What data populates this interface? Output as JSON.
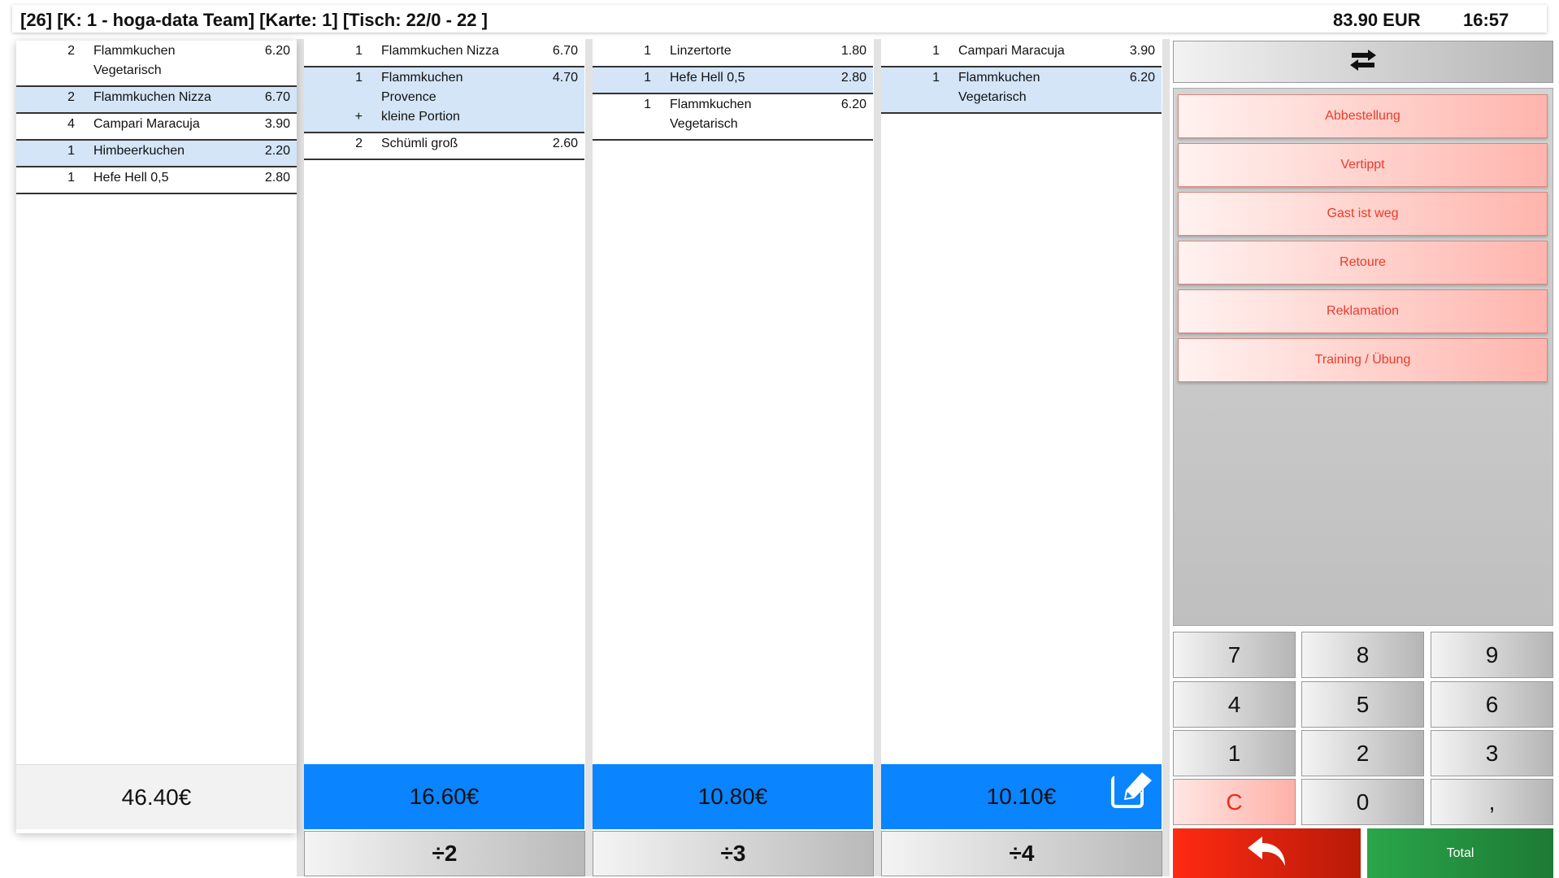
{
  "header": {
    "title": "[26] [K: 1 - hoga-data Team] [Karte: 1] [Tisch: 22/0 - 22 ]",
    "amount": "83.90 EUR",
    "time": "16:57"
  },
  "columns": [
    {
      "rows": [
        {
          "qty": "2",
          "lines": [
            "Flammkuchen",
            "Vegetarisch"
          ],
          "price": "6.20",
          "selected": false
        },
        {
          "qty": "2",
          "lines": [
            "Flammkuchen Nizza"
          ],
          "price": "6.70",
          "selected": true
        },
        {
          "qty": "4",
          "lines": [
            "Campari Maracuja"
          ],
          "price": "3.90",
          "selected": false
        },
        {
          "qty": "1",
          "lines": [
            "Himbeerkuchen"
          ],
          "price": "2.20",
          "selected": true
        },
        {
          "qty": "1",
          "lines": [
            "Hefe Hell 0,5"
          ],
          "price": "2.80",
          "selected": false
        }
      ],
      "total": "46.40€"
    },
    {
      "rows": [
        {
          "qty": "1",
          "lines": [
            "Flammkuchen Nizza"
          ],
          "price": "6.70",
          "selected": false
        },
        {
          "qty": "1",
          "lines": [
            "Flammkuchen",
            "Provence"
          ],
          "extra_prefix": "+",
          "extra": "kleine Portion",
          "price": "4.70",
          "selected": true
        },
        {
          "qty": "2",
          "lines": [
            "Schümli groß"
          ],
          "price": "2.60",
          "selected": false
        }
      ],
      "total": "16.60€",
      "split_label": "÷2"
    },
    {
      "rows": [
        {
          "qty": "1",
          "lines": [
            "Linzertorte"
          ],
          "price": "1.80",
          "selected": false
        },
        {
          "qty": "1",
          "lines": [
            "Hefe Hell 0,5"
          ],
          "price": "2.80",
          "selected": true
        },
        {
          "qty": "1",
          "lines": [
            "Flammkuchen",
            "Vegetarisch"
          ],
          "price": "6.20",
          "selected": false
        }
      ],
      "total": "10.80€",
      "split_label": "÷3"
    },
    {
      "rows": [
        {
          "qty": "1",
          "lines": [
            "Campari Maracuja"
          ],
          "price": "3.90",
          "selected": false
        },
        {
          "qty": "1",
          "lines": [
            "Flammkuchen",
            "Vegetarisch"
          ],
          "price": "6.20",
          "selected": true
        }
      ],
      "total": "10.10€",
      "split_label": "÷4",
      "edit_icon": "edit-icon"
    }
  ],
  "right_panel": {
    "swap_icon": "swap-arrows-icon",
    "reasons": [
      "Abbestellung",
      "Vertippt",
      "Gast ist weg",
      "Retoure",
      "Reklamation",
      "Training / Übung"
    ],
    "keypad": [
      "7",
      "8",
      "9",
      "4",
      "5",
      "6",
      "1",
      "2",
      "3",
      "C",
      "0",
      ","
    ],
    "back_icon": "undo-arrow-icon",
    "total_label": "Total"
  },
  "colors": {
    "selected_row": "#d3e5f7",
    "total_blue": "#0a84ff",
    "reason_text": "#ee3a2a",
    "back_red": "#ff2a12",
    "total_green": "#2aa64a"
  }
}
